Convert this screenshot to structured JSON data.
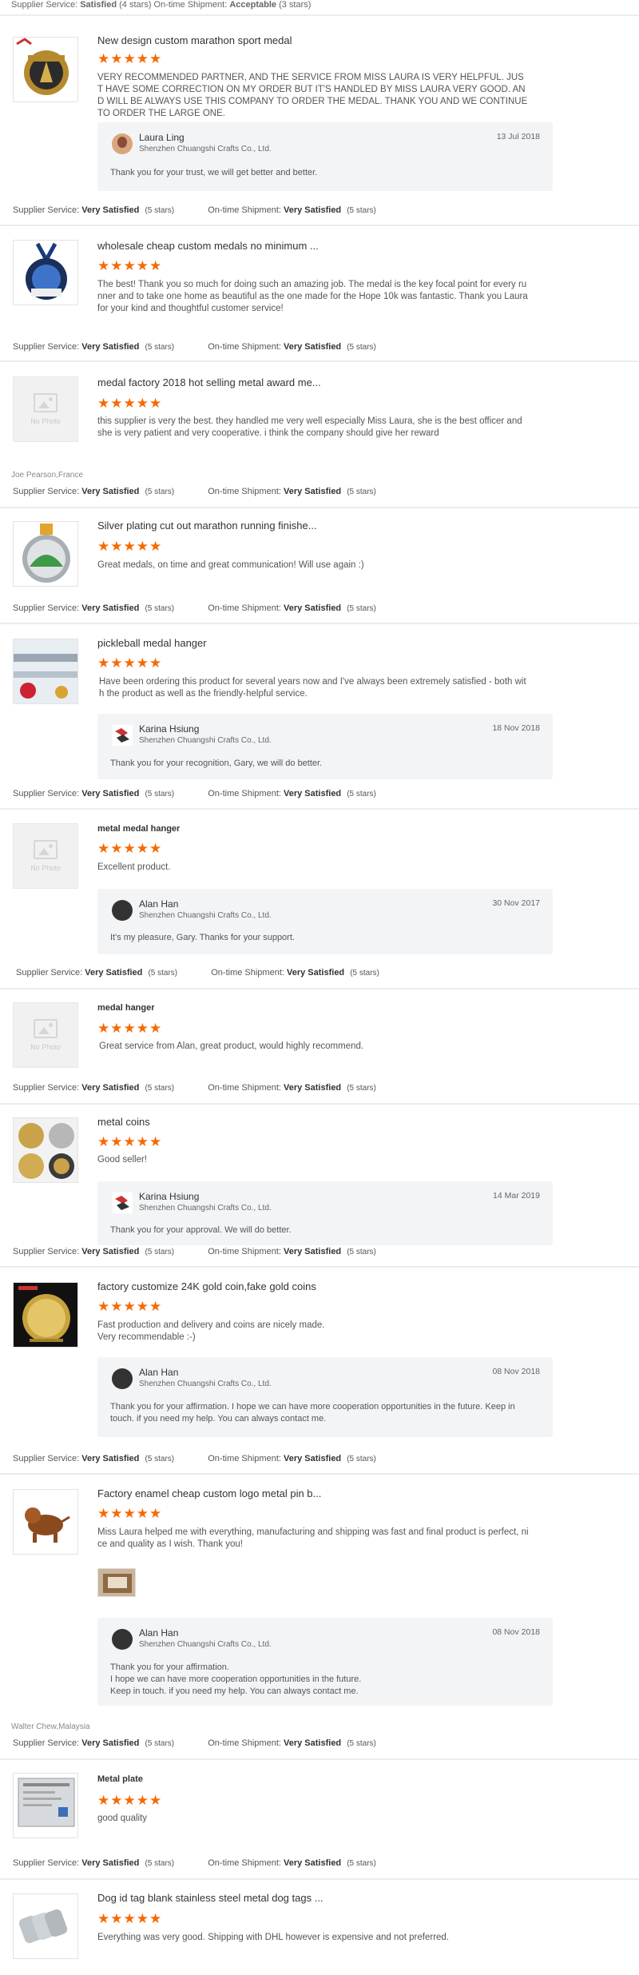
{
  "top_rating": {
    "supplier_label": "Supplier Service:",
    "supplier_value": "Satisfied",
    "supplier_count": "(4 stars)",
    "shipment_label": "On-time Shipment:",
    "shipment_value": "Acceptable",
    "shipment_count": "(3 stars)"
  },
  "labels": {
    "supplier_service": "Supplier Service:",
    "ontime_shipment": "On-time Shipment:",
    "no_photo": "No Photo",
    "stars_glyph": "★★★★★"
  },
  "reviews": [
    {
      "title": "New design custom marathon sport medal",
      "stars": 5,
      "text": "VERY RECOMMENDED PARTNER, AND THE SERVICE FROM MISS LAURA IS VERY HELPFUL. JUST HAVE SOME CORRECTION ON MY ORDER BUT IT'S HANDLED BY MISS LAURA VERY GOOD. AND WILL BE ALWAYS USE THIS COMPANY TO ORDER THE MEDAL. THANK YOU AND WE CONTINUE TO ORDER THE LARGE ONE.",
      "reply": {
        "name": "Laura Ling",
        "company": "Shenzhen Chuangshi Crafts Co., Ltd.",
        "date": "13 Jul 2018",
        "text": "Thank you for your trust, we will get better and better."
      },
      "supplier": "Very Satisfied",
      "supplier_count": "(5 stars)",
      "shipment": "Very Satisfied",
      "shipment_count": "(5 stars)"
    },
    {
      "title": "wholesale cheap custom medals no minimum ...",
      "stars": 5,
      "text": "The best!  Thank you so much for doing such an amazing job.  The medal is the key focal point for every runner and to take one home as beautiful as the one made for the Hope 10k was fantastic.  Thank you Laura for your kind and thoughtful customer service!",
      "supplier": "Very Satisfied",
      "supplier_count": "(5 stars)",
      "shipment": "Very Satisfied",
      "shipment_count": "(5 stars)"
    },
    {
      "title": "medal factory 2018 hot selling metal award me...",
      "stars": 5,
      "text": "this supplier is very the best.  they handled me very well especially Miss Laura, she is the best officer and she is very patient and very cooperative. i think the company should give her reward",
      "buyer": "Joe Pearson,France",
      "supplier": "Very Satisfied",
      "supplier_count": "(5 stars)",
      "shipment": "Very Satisfied",
      "shipment_count": "(5 stars)"
    },
    {
      "title": "Silver plating cut out marathon running finishe...",
      "stars": 5,
      "text": "Great medals, on time and great communication! Will use again :)",
      "supplier": "Very Satisfied",
      "supplier_count": "(5 stars)",
      "shipment": "Very Satisfied",
      "shipment_count": "(5 stars)"
    },
    {
      "title": "pickleball medal hanger",
      "stars": 5,
      "text": "Have been ordering this product for several years now and I've always been extremely satisfied - both with the product as well as the friendly-helpful service.",
      "reply": {
        "name": "Karina Hsiung",
        "company": "Shenzhen Chuangshi Crafts Co., Ltd.",
        "date": "18 Nov 2018",
        "text": "Thank you for your recognition, Gary, we will do better."
      },
      "supplier": "Very Satisfied",
      "supplier_count": "(5 stars)",
      "shipment": "Very Satisfied",
      "shipment_count": "(5 stars)"
    },
    {
      "title": "metal medal hanger",
      "stars": 5,
      "text": "Excellent product.",
      "reply": {
        "name": "Alan Han",
        "company": "Shenzhen Chuangshi Crafts Co., Ltd.",
        "date": "30 Nov 2017",
        "text": "It's my pleasure, Gary. Thanks for your support."
      },
      "supplier": "Very Satisfied",
      "supplier_count": "(5 stars)",
      "shipment": "Very Satisfied",
      "shipment_count": "(5 stars)"
    },
    {
      "title": "medal hanger",
      "stars": 5,
      "text": "Great service from Alan, great product, would highly recommend.",
      "supplier": "Very Satisfied",
      "supplier_count": "(5 stars)",
      "shipment": "Very Satisfied",
      "shipment_count": "(5 stars)"
    },
    {
      "title": "metal coins",
      "stars": 5,
      "text": "Good seller!",
      "reply": {
        "name": "Karina Hsiung",
        "company": "Shenzhen Chuangshi Crafts Co., Ltd.",
        "date": "14 Mar 2019",
        "text": "Thank you for your approval. We will do better."
      },
      "supplier": "Very Satisfied",
      "supplier_count": "(5 stars)",
      "shipment": "Very Satisfied",
      "shipment_count": "(5 stars)"
    },
    {
      "title": "factory customize 24K gold coin,fake gold coins",
      "stars": 5,
      "text": "Fast production and delivery and coins are nicely made.\nVery recommendable :-)",
      "reply": {
        "name": "Alan Han",
        "company": "Shenzhen Chuangshi Crafts Co., Ltd.",
        "date": "08 Nov 2018",
        "text": "Thank you for your affirmation. I hope we can have more cooperation opportunities in the future. Keep in touch. if you need my help. You can always contact me."
      },
      "supplier": "Very Satisfied",
      "supplier_count": "(5 stars)",
      "shipment": "Very Satisfied",
      "shipment_count": "(5 stars)"
    },
    {
      "title": "Factory enamel cheap custom logo metal pin b...",
      "stars": 5,
      "text": "Miss Laura helped me with everything, manufacturing and shipping was fast and final product is perfect, nice and quality as I wish. Thank you!",
      "reply": {
        "name": "Alan Han",
        "company": "Shenzhen Chuangshi Crafts Co., Ltd.",
        "date": "08 Nov 2018",
        "text": "Thank you for your affirmation.\nI hope we can have more cooperation opportunities in the future.\nKeep in touch. if you need my help. You can always contact me."
      },
      "buyer": "Walter Chew,Malaysia",
      "supplier": "Very Satisfied",
      "supplier_count": "(5 stars)",
      "shipment": "Very Satisfied",
      "shipment_count": "(5 stars)"
    },
    {
      "title": "Metal plate",
      "stars": 5,
      "text": "good quality",
      "supplier": "Very Satisfied",
      "supplier_count": "(5 stars)",
      "shipment": "Very Satisfied",
      "shipment_count": "(5 stars)"
    },
    {
      "title": "Dog id tag blank stainless steel metal dog tags ...",
      "stars": 5,
      "text": "Everything was very good. Shipping with DHL however is expensive and not preferred."
    }
  ]
}
